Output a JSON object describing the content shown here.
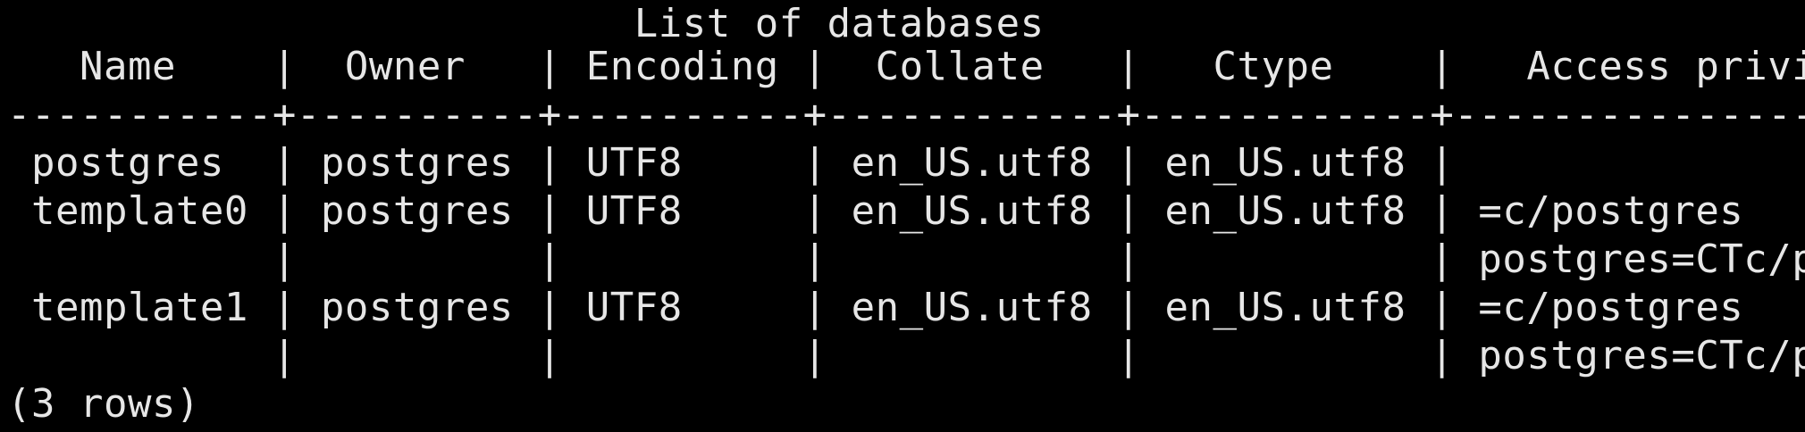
{
  "terminal": {
    "background": "#000000",
    "foreground": "#e6e6e6",
    "lines": [
      "                          List of databases",
      "   Name    |  Owner   | Encoding |  Collate   |   Ctype    |   Access privileges",
      "-----------+----------+----------+------------+------------+-----------------------",
      " postgres  | postgres | UTF8     | en_US.utf8 | en_US.utf8 |",
      " template0 | postgres | UTF8     | en_US.utf8 | en_US.utf8 | =c/postgres          +",
      "           |          |          |            |            | postgres=CTc/postgres",
      " template1 | postgres | UTF8     | en_US.utf8 | en_US.utf8 | =c/postgres          +",
      "           |          |          |            |            | postgres=CTc/postgres",
      "(3 rows)"
    ]
  }
}
